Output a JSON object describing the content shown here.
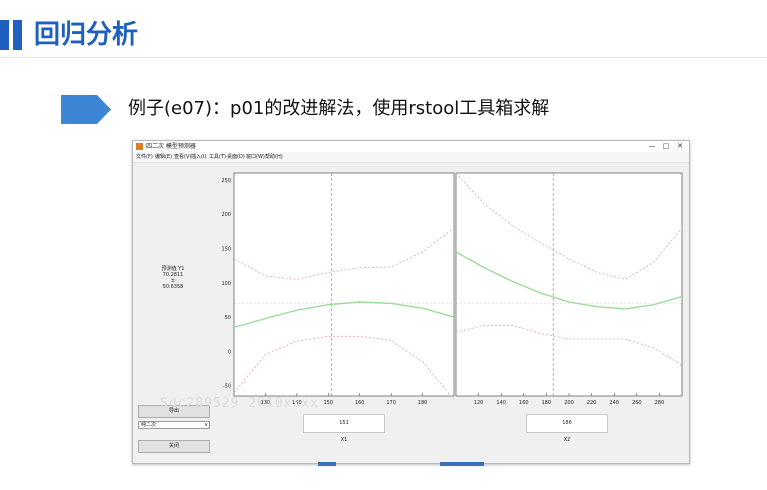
{
  "slide": {
    "heading": "回归分析",
    "example_text": "例子(e07)：p01的改进解法，使用rstool工具箱求解",
    "watermark": "Sdc289529 2010xxxx"
  },
  "window": {
    "title": "四二次 模型预测器",
    "controls": [
      "—",
      "□",
      "✕"
    ],
    "menus": [
      "文件(F)",
      "编辑(E)",
      "查看(V)",
      "插入(I)",
      "工具(T)",
      "桌面(D)",
      "窗口(W)",
      "帮助(H)"
    ]
  },
  "sidebar": {
    "pred_label": "预测值 Y1",
    "pred_value": "70.2811",
    "pm": "±",
    "ci_value": "50.6358",
    "export_button": "导出",
    "model_select": "纯二次",
    "model_arrow": "∨",
    "close_button": "关闭"
  },
  "inputs": {
    "x1_value": "151",
    "x1_name": "X1",
    "x2_value": "186",
    "x2_name": "X2"
  },
  "chart_data": {
    "type": "line",
    "ylim": [
      -65,
      260
    ],
    "yticks": [
      -50,
      0,
      50,
      100,
      150,
      200,
      250
    ],
    "predicted_y": 70.2811,
    "colors": {
      "fit": "#9ddb9d",
      "ci": "#e0a0b8",
      "ref": "#888888"
    },
    "panels": [
      {
        "xname": "X1",
        "xlim": [
          120,
          190
        ],
        "xticks": [
          130,
          140,
          150,
          160,
          170,
          180
        ],
        "current_x": 151,
        "series": [
          {
            "x": [
              120,
              130,
              140,
              150,
              160,
              170,
              180,
              190
            ],
            "fit": [
              35,
              48,
              60,
              68,
              72,
              70,
              63,
              50
            ],
            "upper": [
              135,
              110,
              105,
              115,
              122,
              123,
              145,
              180
            ],
            "lower": [
              -60,
              -5,
              15,
              22,
              22,
              16,
              -15,
              -70
            ]
          }
        ]
      },
      {
        "xname": "X2",
        "xlim": [
          100,
          300
        ],
        "xticks": [
          120,
          140,
          160,
          180,
          200,
          220,
          240,
          260,
          280
        ],
        "current_x": 186,
        "series": [
          {
            "x": [
              100,
              125,
              150,
              175,
              200,
              225,
              250,
              275,
              300
            ],
            "fit": [
              145,
              122,
              102,
              85,
              72,
              65,
              62,
              68,
              80
            ],
            "upper": [
              260,
              215,
              183,
              158,
              135,
              115,
              105,
              130,
              180
            ],
            "lower": [
              28,
              38,
              38,
              26,
              18,
              18,
              18,
              5,
              -20
            ]
          }
        ]
      }
    ]
  }
}
